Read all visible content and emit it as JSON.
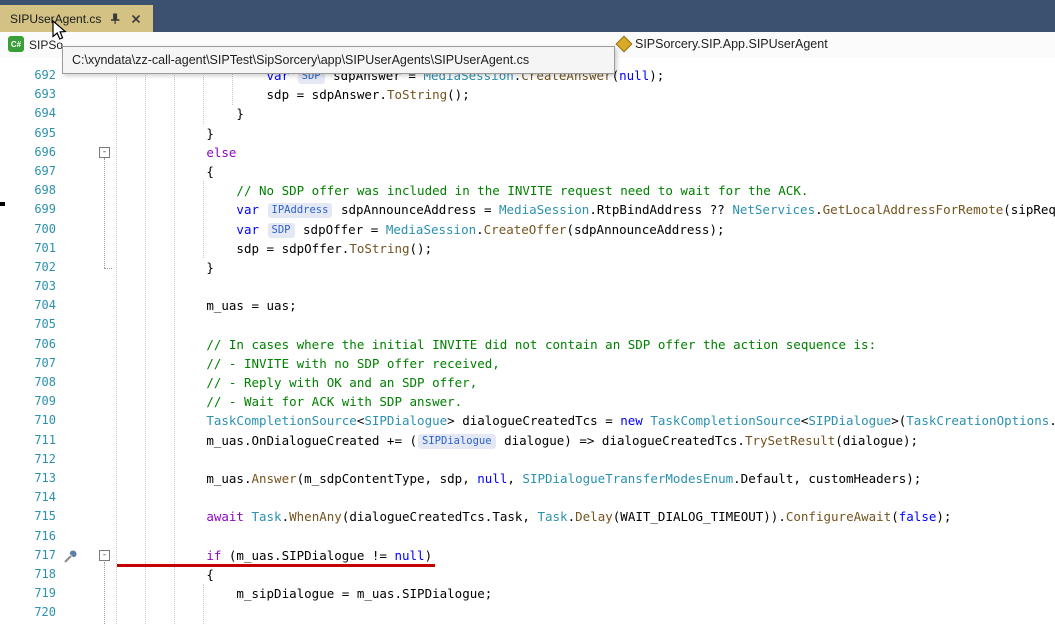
{
  "tab": {
    "title": "SIPUserAgent.cs"
  },
  "navbar": {
    "project_icon_text": "C#",
    "project": "SIPSo",
    "breadcrumb": "SIPSorcery.SIP.App.SIPUserAgent"
  },
  "tooltip": {
    "path": "C:\\xyndata\\zz-call-agent\\SIPTest\\SipSorcery\\app\\SIPUserAgents\\SIPUserAgent.cs"
  },
  "icons": {
    "pin-icon": "pushpin",
    "close-icon": "x-cross",
    "csharp-project-icon": "green C# square",
    "class-icon": "amber class diamond",
    "quick-actions-icon": "screwdriver",
    "cursor-icon": "mouse-pointer-arrow"
  },
  "colors": {
    "tab_strip_bg": "#3C5170",
    "active_tab_bg": "#D3C284",
    "line_number": "#2B91AF",
    "keyword": "#0000FF",
    "control_keyword": "#8F08C4",
    "type": "#2B91AF",
    "method": "#74531F",
    "comment": "#008000",
    "red_underline": "#C40000"
  },
  "editor": {
    "annotations": {
      "red_underline_line": "717",
      "quick_action_line": "717"
    },
    "lines": [
      {
        "num": "692",
        "indent": 20,
        "segs": [
          {
            "t": "var ",
            "c": "k"
          },
          {
            "t": "SDP",
            "c": "h"
          },
          {
            "t": " sdpAnswer = ",
            "c": "p"
          },
          {
            "t": "MediaSession",
            "c": "t"
          },
          {
            "t": ".",
            "c": "p"
          },
          {
            "t": "CreateAnswer",
            "c": "m"
          },
          {
            "t": "(",
            "c": "p"
          },
          {
            "t": "null",
            "c": "k"
          },
          {
            "t": ");",
            "c": "p"
          }
        ]
      },
      {
        "num": "693",
        "indent": 20,
        "segs": [
          {
            "t": "sdp = sdpAnswer.",
            "c": "p"
          },
          {
            "t": "ToString",
            "c": "m"
          },
          {
            "t": "();",
            "c": "p"
          }
        ]
      },
      {
        "num": "694",
        "indent": 16,
        "segs": [
          {
            "t": "}",
            "c": "p"
          }
        ]
      },
      {
        "num": "695",
        "indent": 12,
        "segs": [
          {
            "t": "}",
            "c": "p"
          }
        ]
      },
      {
        "num": "696",
        "indent": 12,
        "fold": "-",
        "segs": [
          {
            "t": "else",
            "c": "c"
          }
        ]
      },
      {
        "num": "697",
        "indent": 12,
        "segs": [
          {
            "t": "{",
            "c": "p"
          }
        ]
      },
      {
        "num": "698",
        "indent": 16,
        "segs": [
          {
            "t": "// No SDP offer was included in the INVITE request need to wait for the ACK.",
            "c": "g"
          }
        ]
      },
      {
        "num": "699",
        "indent": 16,
        "segs": [
          {
            "t": "var ",
            "c": "k"
          },
          {
            "t": "IPAddress",
            "c": "h"
          },
          {
            "t": " sdpAnnounceAddress = ",
            "c": "p"
          },
          {
            "t": "MediaSession",
            "c": "t"
          },
          {
            "t": ".RtpBindAddress ?? ",
            "c": "p"
          },
          {
            "t": "NetServices",
            "c": "t"
          },
          {
            "t": ".",
            "c": "p"
          },
          {
            "t": "GetLocalAddressForRemote",
            "c": "m"
          },
          {
            "t": "(sipRequest",
            "c": "p"
          }
        ]
      },
      {
        "num": "700",
        "indent": 16,
        "segs": [
          {
            "t": "var ",
            "c": "k"
          },
          {
            "t": "SDP",
            "c": "h"
          },
          {
            "t": " sdpOffer = ",
            "c": "p"
          },
          {
            "t": "MediaSession",
            "c": "t"
          },
          {
            "t": ".",
            "c": "p"
          },
          {
            "t": "CreateOffer",
            "c": "m"
          },
          {
            "t": "(sdpAnnounceAddress);",
            "c": "p"
          }
        ]
      },
      {
        "num": "701",
        "indent": 16,
        "segs": [
          {
            "t": "sdp = sdpOffer.",
            "c": "p"
          },
          {
            "t": "ToString",
            "c": "m"
          },
          {
            "t": "();",
            "c": "p"
          }
        ]
      },
      {
        "num": "702",
        "indent": 12,
        "segs": [
          {
            "t": "}",
            "c": "p"
          }
        ]
      },
      {
        "num": "703",
        "indent": 0,
        "segs": []
      },
      {
        "num": "704",
        "indent": 12,
        "segs": [
          {
            "t": "m_uas = uas;",
            "c": "p"
          }
        ]
      },
      {
        "num": "705",
        "indent": 0,
        "segs": []
      },
      {
        "num": "706",
        "indent": 12,
        "segs": [
          {
            "t": "// In cases where the initial INVITE did not contain an SDP offer the action sequence is:",
            "c": "g"
          }
        ]
      },
      {
        "num": "707",
        "indent": 12,
        "segs": [
          {
            "t": "// - INVITE with no SDP offer received,",
            "c": "g"
          }
        ]
      },
      {
        "num": "708",
        "indent": 12,
        "segs": [
          {
            "t": "// - Reply with OK and an SDP offer,",
            "c": "g"
          }
        ]
      },
      {
        "num": "709",
        "indent": 12,
        "segs": [
          {
            "t": "// - Wait for ACK with SDP answer.",
            "c": "g"
          }
        ]
      },
      {
        "num": "710",
        "indent": 12,
        "segs": [
          {
            "t": "TaskCompletionSource",
            "c": "t"
          },
          {
            "t": "<",
            "c": "p"
          },
          {
            "t": "SIPDialogue",
            "c": "t"
          },
          {
            "t": "> dialogueCreatedTcs = ",
            "c": "p"
          },
          {
            "t": "new",
            "c": "k"
          },
          {
            "t": " ",
            "c": "p"
          },
          {
            "t": "TaskCompletionSource",
            "c": "t"
          },
          {
            "t": "<",
            "c": "p"
          },
          {
            "t": "SIPDialogue",
            "c": "t"
          },
          {
            "t": ">(",
            "c": "p"
          },
          {
            "t": "TaskCreationOptions",
            "c": "t"
          },
          {
            "t": ".Run",
            "c": "p"
          }
        ]
      },
      {
        "num": "711",
        "indent": 12,
        "segs": [
          {
            "t": "m_uas.OnDialogueCreated += (",
            "c": "p"
          },
          {
            "t": "SIPDialogue",
            "c": "h"
          },
          {
            "t": " dialogue) => dialogueCreatedTcs.",
            "c": "p"
          },
          {
            "t": "TrySetResult",
            "c": "m"
          },
          {
            "t": "(dialogue);",
            "c": "p"
          }
        ]
      },
      {
        "num": "712",
        "indent": 0,
        "segs": []
      },
      {
        "num": "713",
        "indent": 12,
        "segs": [
          {
            "t": "m_uas.",
            "c": "p"
          },
          {
            "t": "Answer",
            "c": "m"
          },
          {
            "t": "(m_sdpContentType, sdp, ",
            "c": "p"
          },
          {
            "t": "null",
            "c": "k"
          },
          {
            "t": ", ",
            "c": "p"
          },
          {
            "t": "SIPDialogueTransferModesEnum",
            "c": "t"
          },
          {
            "t": ".Default, customHeaders);",
            "c": "p"
          }
        ]
      },
      {
        "num": "714",
        "indent": 0,
        "segs": []
      },
      {
        "num": "715",
        "indent": 12,
        "segs": [
          {
            "t": "await",
            "c": "c"
          },
          {
            "t": " ",
            "c": "p"
          },
          {
            "t": "Task",
            "c": "t"
          },
          {
            "t": ".",
            "c": "p"
          },
          {
            "t": "WhenAny",
            "c": "m"
          },
          {
            "t": "(dialogueCreatedTcs.Task, ",
            "c": "p"
          },
          {
            "t": "Task",
            "c": "t"
          },
          {
            "t": ".",
            "c": "p"
          },
          {
            "t": "Delay",
            "c": "m"
          },
          {
            "t": "(WAIT_DIALOG_TIMEOUT)).",
            "c": "p"
          },
          {
            "t": "ConfigureAwait",
            "c": "m"
          },
          {
            "t": "(",
            "c": "p"
          },
          {
            "t": "false",
            "c": "k"
          },
          {
            "t": ");",
            "c": "p"
          }
        ]
      },
      {
        "num": "716",
        "indent": 0,
        "segs": []
      },
      {
        "num": "717",
        "indent": 12,
        "fold": "-",
        "segs": [
          {
            "t": "if",
            "c": "c"
          },
          {
            "t": " (m_uas.SIPDialogue != ",
            "c": "p"
          },
          {
            "t": "null",
            "c": "k"
          },
          {
            "t": ")",
            "c": "p"
          }
        ]
      },
      {
        "num": "718",
        "indent": 12,
        "segs": [
          {
            "t": "{",
            "c": "p"
          }
        ]
      },
      {
        "num": "719",
        "indent": 16,
        "segs": [
          {
            "t": "m_sipDialogue = m_uas.SIPDialogue;",
            "c": "p"
          }
        ]
      },
      {
        "num": "720",
        "indent": 0,
        "segs": []
      }
    ]
  }
}
